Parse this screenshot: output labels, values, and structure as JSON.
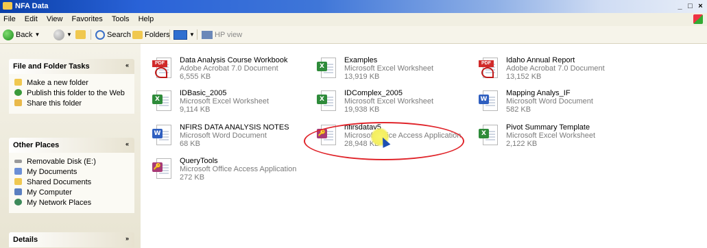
{
  "window": {
    "title": "NFA Data",
    "buttons": {
      "minimize": "_",
      "maximize": "□",
      "close": "×"
    }
  },
  "menu": [
    "File",
    "Edit",
    "View",
    "Favorites",
    "Tools",
    "Help"
  ],
  "toolbar": {
    "back_label": "Back",
    "search_label": "Search",
    "folders_label": "Folders",
    "hp_label": "HP view"
  },
  "tasks_pane": {
    "file_folder_tasks": {
      "title": "File and Folder Tasks",
      "items": [
        "Make a new folder",
        "Publish this folder to the Web",
        "Share this folder"
      ]
    },
    "other_places": {
      "title": "Other Places",
      "items": [
        "Removable Disk (E:)",
        "My Documents",
        "Shared Documents",
        "My Computer",
        "My Network Places"
      ]
    },
    "details": {
      "title": "Details"
    }
  },
  "files": [
    {
      "name": "Data Analysis Course Workbook",
      "type": "Adobe Acrobat 7.0 Document",
      "size": "6,555 KB",
      "icon": "pdf-icon"
    },
    {
      "name": "Examples",
      "type": "Microsoft Excel Worksheet",
      "size": "13,919 KB",
      "icon": "excel-icon"
    },
    {
      "name": "Idaho Annual Report",
      "type": "Adobe Acrobat 7.0 Document",
      "size": "13,152 KB",
      "icon": "pdf-icon"
    },
    {
      "name": "IDBasic_2005",
      "type": "Microsoft Excel Worksheet",
      "size": "9,114 KB",
      "icon": "excel-icon"
    },
    {
      "name": "IDComplex_2005",
      "type": "Microsoft Excel Worksheet",
      "size": "19,938 KB",
      "icon": "excel-icon"
    },
    {
      "name": "Mapping Analys_IF",
      "type": "Microsoft Word Document",
      "size": "582 KB",
      "icon": "word-icon"
    },
    {
      "name": "NFIRS DATA ANALYSIS NOTES",
      "type": "Microsoft Word Document",
      "size": "68 KB",
      "icon": "word-icon"
    },
    {
      "name": "nfirsdatav5",
      "type": "Microsoft Office Access Application",
      "size": "28,948 KB",
      "icon": "access-icon"
    },
    {
      "name": "Pivot Summary Template",
      "type": "Microsoft Excel Worksheet",
      "size": "2,122 KB",
      "icon": "excel-icon"
    },
    {
      "name": "QueryTools",
      "type": "Microsoft Office Access Application",
      "size": "272 KB",
      "icon": "access-icon"
    }
  ],
  "colors": {
    "highlight_oval": "#e0242a",
    "highlight_spot": "#f3ee60",
    "cursor": "#1d4fb3"
  }
}
